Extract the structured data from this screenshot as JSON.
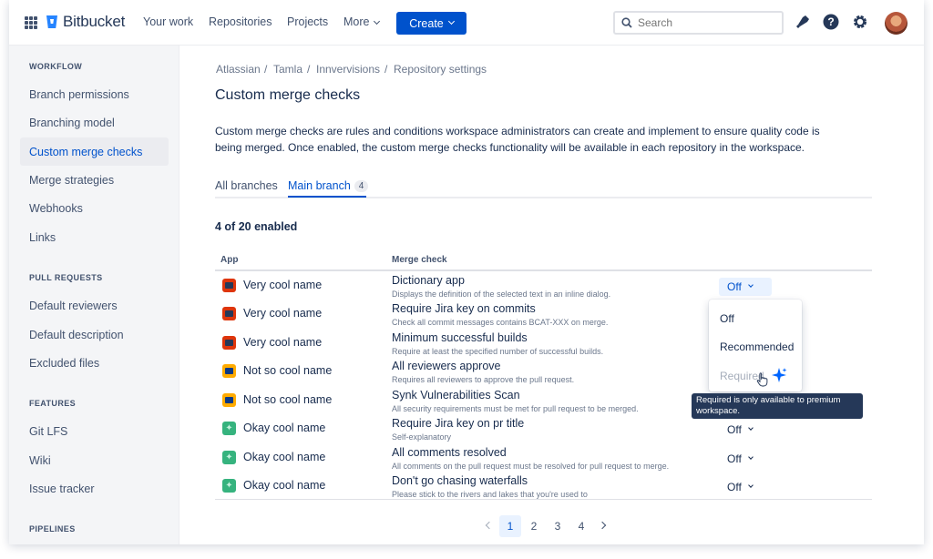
{
  "topnav": {
    "product": "Bitbucket",
    "links": [
      "Your work",
      "Repositories",
      "Projects",
      "More"
    ],
    "create_label": "Create",
    "search_placeholder": "Search",
    "brand_color": "#0052cc"
  },
  "sidebar": {
    "sections": [
      {
        "heading": "WORKFLOW",
        "items": [
          "Branch permissions",
          "Branching model",
          "Custom merge checks",
          "Merge strategies",
          "Webhooks",
          "Links"
        ]
      },
      {
        "heading": "PULL REQUESTS",
        "items": [
          "Default reviewers",
          "Default description",
          "Excluded files"
        ]
      },
      {
        "heading": "FEATURES",
        "items": [
          "Git LFS",
          "Wiki",
          "Issue tracker"
        ]
      },
      {
        "heading": "PIPELINES",
        "items": []
      }
    ],
    "active_item": "Custom merge checks"
  },
  "breadcrumb": [
    "Atlassian",
    "Tamla",
    "Innvervisions",
    "Repository settings"
  ],
  "page_title": "Custom merge checks",
  "description": "Custom merge checks are rules and conditions workspace administrators can create and implement to ensure quality code is being merged. Once enabled, the custom merge checks functionality will be available in each repository in the workspace.",
  "tabs": [
    {
      "label": "All branches",
      "active": false
    },
    {
      "label": "Main branch",
      "active": true,
      "count": "4"
    }
  ],
  "enabled_summary": "4 of 20 enabled",
  "table": {
    "columns": [
      "App",
      "Merge check"
    ],
    "rows": [
      {
        "app": "Very cool name",
        "icon": "red",
        "check": "Dictionary app",
        "desc": "Displays the definition of the selected text in an inline dialog.",
        "status": "Off",
        "open": true
      },
      {
        "app": "Very cool name",
        "icon": "red",
        "check": "Require Jira key on commits",
        "desc": "Check all commit messages contains BCAT-XXX on merge.",
        "status": ""
      },
      {
        "app": "Very cool name",
        "icon": "red",
        "check": "Minimum successful builds",
        "desc": "Require at least the specified number of successful builds.",
        "status": ""
      },
      {
        "app": "Not so cool name",
        "icon": "yellow",
        "check": "All reviewers approve",
        "desc": "Requires all reviewers to approve the pull request.",
        "status": ""
      },
      {
        "app": "Not so cool name",
        "icon": "yellow",
        "check": "Synk Vulnerabilities Scan",
        "desc": "All security requirements must be met for pull request to be merged.",
        "status": ""
      },
      {
        "app": "Okay cool name",
        "icon": "green",
        "check": "Require Jira key on pr title",
        "desc": "Self-explanatory",
        "status": "Off"
      },
      {
        "app": "Okay cool name",
        "icon": "green",
        "check": "All comments resolved",
        "desc": "All comments on the pull request must be resolved for pull request to merge.",
        "status": "Off"
      },
      {
        "app": "Okay cool name",
        "icon": "green",
        "check": "Don't go chasing waterfalls",
        "desc": "Please stick to the rivers and lakes that you're used to",
        "status": "Off"
      }
    ]
  },
  "dropdown": {
    "options": [
      "Off",
      "Recommended",
      "Required"
    ],
    "disabled_option": "Required",
    "tooltip": "Required is only available to premium workspace."
  },
  "pagination": {
    "pages": [
      "1",
      "2",
      "3",
      "4"
    ],
    "current": "1"
  }
}
